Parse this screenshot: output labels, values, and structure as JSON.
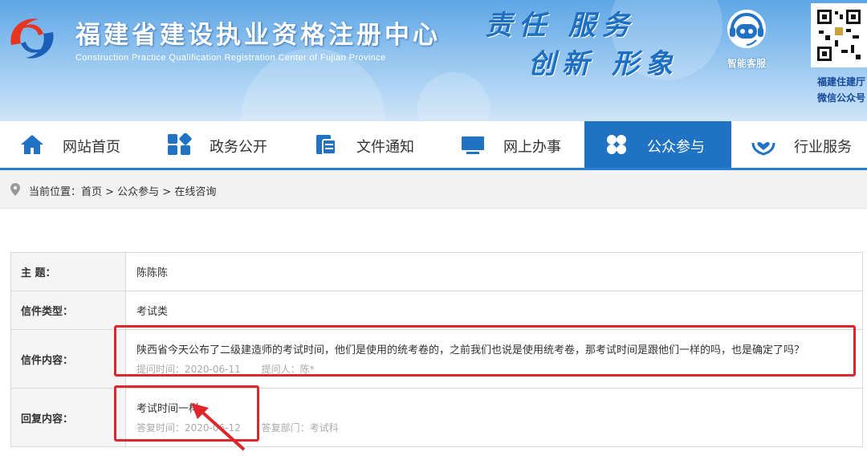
{
  "header": {
    "site_title": "福建省建设执业资格注册中心",
    "site_subtitle": "Construction Practice Qualification Registration Center of Fujian Province",
    "slogan_line1": "责任 服务",
    "slogan_line2": "创新 形象",
    "service_label": "智能客服",
    "qr_caption_line1": "福建住建厅",
    "qr_caption_line2": "微信公众号"
  },
  "nav": {
    "items": [
      {
        "label": "网站首页",
        "icon": "home-icon"
      },
      {
        "label": "政务公开",
        "icon": "blocks-icon"
      },
      {
        "label": "文件通知",
        "icon": "document-icon"
      },
      {
        "label": "网上办事",
        "icon": "monitor-icon"
      },
      {
        "label": "公众参与",
        "icon": "clover-icon",
        "active": true
      },
      {
        "label": "行业服务",
        "icon": "heart-hands-icon"
      }
    ]
  },
  "breadcrumb": {
    "text": "当前位置：首页 > 公众参与 > 在线咨询"
  },
  "letter": {
    "subject_label": "主    题：",
    "subject_value": "陈陈陈",
    "type_label": "信件类型：",
    "type_value": "考试类",
    "content_label": "信件内容：",
    "content_value": "陕西省今天公布了二级建造师的考试时间，他们是使用的统考卷的，之前我们也说是使用统考卷，那考试时间是跟他们一样的吗，也是确定了吗？",
    "ask_time": "提问时间：2020-06-11",
    "asker": "提问人：陈*",
    "reply_label": "回复内容：",
    "reply_value": "考试时间一样。",
    "reply_time": "答复时间：2020-06-12",
    "reply_dept": "答复部门：考试科"
  },
  "colors": {
    "nav_active": "#1f72c4",
    "highlight": "#e0262d"
  }
}
